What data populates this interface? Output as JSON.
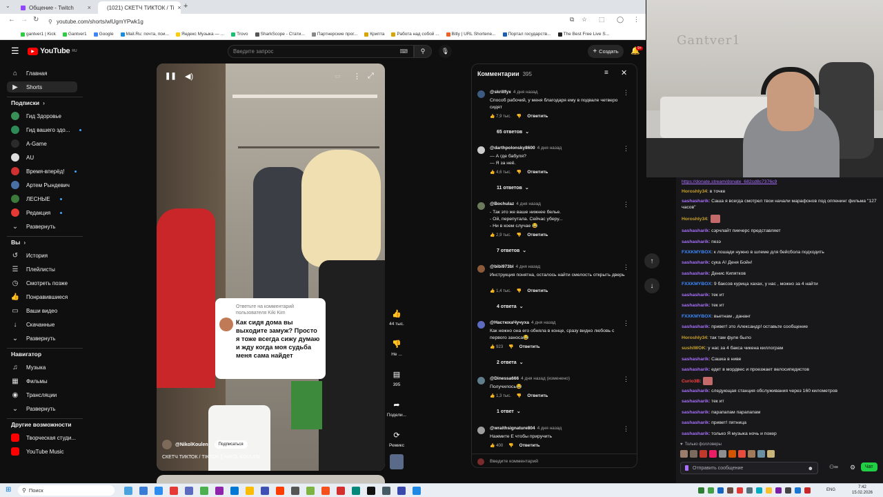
{
  "browser": {
    "tabs": [
      {
        "label": "Общение - Twitch",
        "close": "×"
      },
      {
        "label": "(1021) СКЕТЧ ТИКТОК / Ti",
        "close": "×"
      }
    ],
    "new_tab": "+",
    "url": "youtube.com/shorts/wlUgmYPwk1g",
    "bookmarks": [
      "gantver1 | Kick",
      "Gantver1",
      "Google",
      "Mail.Ru: почта, пои...",
      "Яндекс Музыка — ...",
      "Trovo",
      "SharkScope - Стати...",
      "Партнерские прог...",
      "Крипта",
      "Работа над собой ...",
      "Bitly | URL Shortene...",
      "Портал государств...",
      "The Best Free Live S..."
    ],
    "bookmark_colors": [
      "#2ecc40",
      "#2ecc40",
      "#4285f4",
      "#168de2",
      "#ffcc00",
      "#16c172",
      "#555",
      "#888",
      "#d9a400",
      "#d9a400",
      "#ee6123",
      "#1a5fb4",
      "#222"
    ]
  },
  "youtube": {
    "logo": "YouTube",
    "logo_sup": "RU",
    "search_placeholder": "Введите запрос",
    "create_label": "Создать",
    "notif_badge": "9+",
    "sidebar": {
      "main": [
        {
          "icon": "home-icon",
          "glyph": "⌂",
          "label": "Главная"
        },
        {
          "icon": "shorts-icon",
          "glyph": "▶",
          "label": "Shorts"
        }
      ],
      "subs_title": "Подписки",
      "subs": [
        {
          "label": "Гид Здоровье",
          "color": "#3a8f57",
          "dot": false
        },
        {
          "label": "Гид вашего здо...",
          "color": "#2e8b57",
          "dot": true
        },
        {
          "label": "A-Game",
          "color": "#2b2b2b",
          "dot": false
        },
        {
          "label": "AU",
          "color": "#ddd",
          "dot": false
        },
        {
          "label": "Время-вперёд!",
          "color": "#d03030",
          "dot": true
        },
        {
          "label": "Артем Рындевич",
          "color": "#4a6fa5",
          "dot": false
        },
        {
          "label": "ЛЕСНЫЕ",
          "color": "#3b7a3b",
          "dot": true
        },
        {
          "label": "Редакция",
          "color": "#e53935",
          "dot": true
        }
      ],
      "expand1": "Развернуть",
      "you_title": "Вы",
      "you": [
        {
          "icon": "history-icon",
          "glyph": "↺",
          "label": "История"
        },
        {
          "icon": "playlists-icon",
          "glyph": "☰",
          "label": "Плейлисты"
        },
        {
          "icon": "watch-later-icon",
          "glyph": "◷",
          "label": "Смотреть позже"
        },
        {
          "icon": "liked-icon",
          "glyph": "👍",
          "label": "Понравившиеся"
        },
        {
          "icon": "your-videos-icon",
          "glyph": "▭",
          "label": "Ваши видео"
        },
        {
          "icon": "downloads-icon",
          "glyph": "↓",
          "label": "Скачанные"
        }
      ],
      "expand2": "Развернуть",
      "nav_title": "Навигатор",
      "nav": [
        {
          "icon": "music-icon",
          "glyph": "♫",
          "label": "Музыка"
        },
        {
          "icon": "movies-icon",
          "glyph": "▦",
          "label": "Фильмы"
        },
        {
          "icon": "live-icon",
          "glyph": "◉",
          "label": "Трансляции"
        }
      ],
      "expand3": "Развернуть",
      "more_title": "Другие возможности",
      "more": [
        {
          "label": "Творческая студи...",
          "color": "#ff0000"
        },
        {
          "label": "YouTube Music",
          "color": "#ff0000"
        }
      ]
    },
    "short": {
      "reply_header": "Ответьте на комментарий пользователя Kiki Kim",
      "reply_text": "Как сидя дома вы выходите замуж? Просто я тоже всегда сижу думаю и жду когда моя судьба меня сама найдет",
      "channel": "@NikolKoulen",
      "subscribe": "Подписаться",
      "title": "СКЕТЧ ТИКТОК / TIKTOK || NIKOL KOULEN",
      "actions": [
        {
          "icon": "like-icon",
          "glyph": "👍",
          "label": "44 тыс."
        },
        {
          "icon": "dislike-icon",
          "glyph": "👎",
          "label": "Не ..."
        },
        {
          "icon": "comment-icon",
          "glyph": "▤",
          "label": "395"
        },
        {
          "icon": "share-icon",
          "glyph": "➦",
          "label": "Подели..."
        },
        {
          "icon": "remix-icon",
          "glyph": "⟳",
          "label": "Ремикс"
        }
      ]
    },
    "comments_panel": {
      "title": "Комментарии",
      "count": "395",
      "input_placeholder": "Введите комментарий",
      "reply_label": "Ответить",
      "items": [
        {
          "user": "@skrillfyx",
          "time": "4 дня назад",
          "text": "Способ рабочий, у меня благодаря ему в подвале четверо сидят",
          "likes": "7,9 тыс.",
          "replies": "65 ответов",
          "color": "#3d5a80"
        },
        {
          "user": "@darthpolonsky8600",
          "time": "4 дня назад",
          "text": "— А где бабуля?\n— Я за неё.",
          "likes": "4,6 тыс.",
          "replies": "11 ответов",
          "color": "#ccc"
        },
        {
          "user": "@Bochulaz",
          "time": "4 дня назад",
          "text": "- Так это же ваше нижнее белье.\n- Ой, перепутала. Сейчас уберу...\n- Ни в коем случае 😂",
          "likes": "2,9 тыс.",
          "replies": "7 ответов",
          "color": "#6b7a5a"
        },
        {
          "user": "@bibi973bl",
          "time": "4 дня назад",
          "text": "Инструкция понятна, осталось найти смелость открыть дверь",
          "likes": "1,4 тыс.",
          "replies": "4 ответа",
          "color": "#8a5a3a"
        },
        {
          "user": "@НастюхаЧучуха",
          "time": "4 дня назад",
          "text": "Как нежно она его обняла в конце, сразу видно любовь с первого заноса😂",
          "likes": "923",
          "replies": "2 ответа",
          "color": "#5c6bc0"
        },
        {
          "user": "@Dinessa666",
          "time": "4 дня назад (изменено)",
          "text": "Получилось😂",
          "likes": "1,3 тыс.",
          "replies": "1 ответ",
          "color": "#607d8b"
        },
        {
          "user": "@wraithsignature804",
          "time": "4 дня назад",
          "text": "Нажмите Е чтобы приручить",
          "likes": "400",
          "replies": "",
          "color": "#9e9e9e"
        }
      ]
    }
  },
  "stream": {
    "webcam_text": "Gantver1",
    "chat": [
      {
        "user": "",
        "text": "https://donate.stream/donate_682cd8c7376c9",
        "color": "#a970ff",
        "link": true
      },
      {
        "user": "Horoshly34",
        "text": ": в точке",
        "color": "#c9a227"
      },
      {
        "user": "sashasharik",
        "text": ": Саша я всегда смотрел твои начали марафонов под оппенинг фильма \"127 часов\"",
        "color": "#a970ff"
      },
      {
        "user": "Horoshly34",
        "text": ":",
        "color": "#c9a227"
      },
      {
        "user": "sashasharik",
        "text": ": сэрчлайт пикчерс представляет",
        "color": "#a970ff"
      },
      {
        "user": "sashasharik",
        "text": ": пезэ",
        "color": "#a970ff"
      },
      {
        "user": "FXXKMYBOX",
        "text": ": к лошади нужно в шлеме для бейсбола подходить",
        "color": "#3d8aff"
      },
      {
        "user": "sashasharik",
        "text": ": сука А! Деня Бойн!",
        "color": "#a970ff"
      },
      {
        "user": "sashasharik",
        "text": ": Денис Кипятков",
        "color": "#a970ff"
      },
      {
        "user": "FXXKMYBOX",
        "text": ": 9 баксов курица хахах, у нас , можно за 4 найти",
        "color": "#3d8aff"
      },
      {
        "user": "sashasharik",
        "text": ": тек ит",
        "color": "#a970ff"
      },
      {
        "user": "sashasharik",
        "text": ": тек ит",
        "color": "#a970ff"
      },
      {
        "user": "FXXKMYBOX",
        "text": ": вьетнам , дананг",
        "color": "#3d8aff"
      },
      {
        "user": "sashasharik",
        "text": ": привет! это Александр! оставьте сообщение",
        "color": "#a970ff"
      },
      {
        "user": "Horoshly34",
        "text": ": так там фуле было",
        "color": "#c9a227"
      },
      {
        "user": "sushiWOK",
        "text": ": у нас за 4 бакса чикена киллограм",
        "color": "#c9a227"
      },
      {
        "user": "sashasharik",
        "text": ": Сашка в ниве",
        "color": "#a970ff"
      },
      {
        "user": "sashasharik",
        "text": ": едет в мордвес и проезжает велосипедистов",
        "color": "#a970ff"
      },
      {
        "user": "Curio3B",
        "text": ":",
        "color": "#ff4040"
      },
      {
        "user": "sashasharik",
        "text": ": следующая станция обслуживания через 160 километров",
        "color": "#a970ff"
      },
      {
        "user": "sashasharik",
        "text": ": тек ит",
        "color": "#a970ff"
      },
      {
        "user": "sashasharik",
        "text": ": парапапам парапапам",
        "color": "#a970ff"
      },
      {
        "user": "sashasharik",
        "text": ": привет! пятница",
        "color": "#a970ff"
      },
      {
        "user": "sashasharik",
        "text": ": только Я музыка ночь и покер",
        "color": "#a970ff"
      }
    ],
    "followers_only": "Только фолловеры",
    "send_placeholder": "Отправить сообщение",
    "chat_button": "Чат"
  },
  "taskbar": {
    "search": "Поиск",
    "lang": "ENG",
    "time": "7:42",
    "date": "15.02.2026"
  }
}
